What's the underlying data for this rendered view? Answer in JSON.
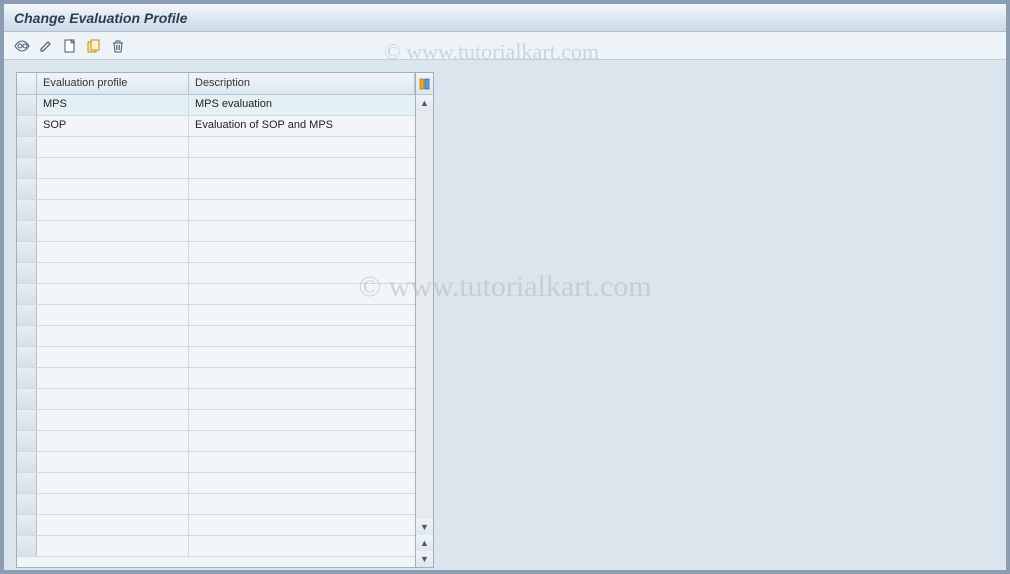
{
  "title": "Change Evaluation Profile",
  "toolbar": {
    "icons": [
      "display",
      "edit",
      "new",
      "copy",
      "delete"
    ]
  },
  "table": {
    "header": {
      "col1": "Evaluation profile",
      "col2": "Description"
    },
    "rows": [
      {
        "profile": "MPS",
        "description": "MPS evaluation"
      },
      {
        "profile": "SOP",
        "description": "Evaluation of SOP and MPS"
      }
    ],
    "empty_rows": 20
  },
  "watermark": "© www.tutorialkart.com"
}
